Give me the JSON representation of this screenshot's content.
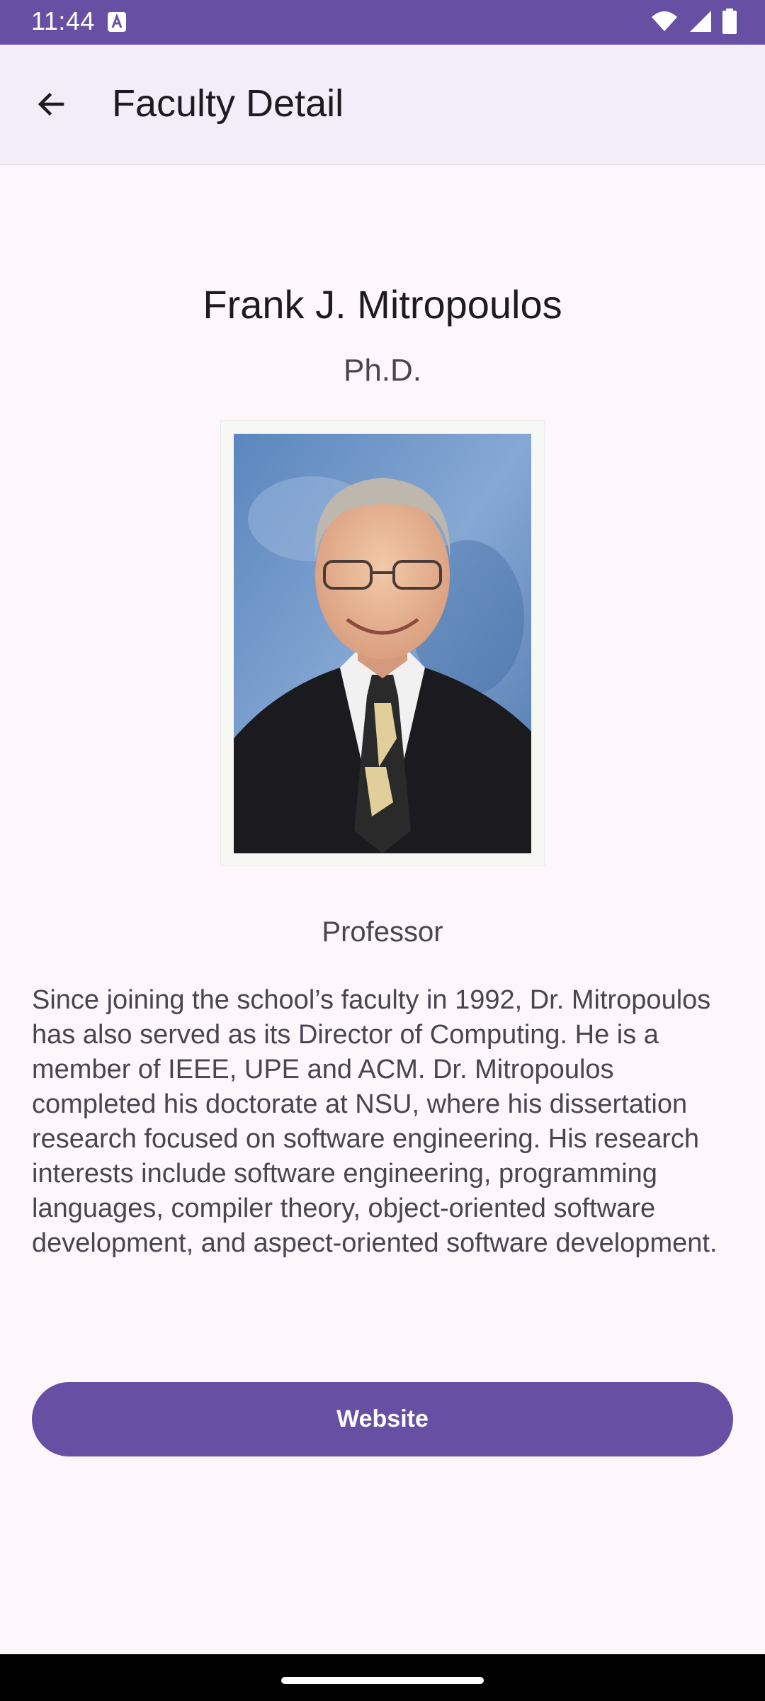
{
  "status_bar": {
    "time": "11:44",
    "badge_letter": "A",
    "icons": [
      "wifi-icon",
      "cell-signal-icon",
      "battery-icon"
    ],
    "background": "#6750a4"
  },
  "app_bar": {
    "back_icon": "arrow-left-icon",
    "title": "Faculty Detail"
  },
  "faculty": {
    "name": "Frank J. Mitropoulos",
    "degree": "Ph.D.",
    "photo_alt": "Portrait photo",
    "position": "Professor",
    "bio": "Since joining the school’s faculty in 1992, Dr. Mitropoulos has also served as its Director of Computing. He is a member of IEEE, UPE and ACM. Dr. Mitropoulos completed his doctorate at NSU, where his dissertation research focused on software engineering. His research interests include software engineering, programming languages, compiler theory, object-oriented software development, and aspect-oriented software development."
  },
  "actions": {
    "website_label": "Website"
  },
  "colors": {
    "accent": "#6750a4",
    "background": "#fdf7fc",
    "app_bar": "#f3edf7"
  }
}
